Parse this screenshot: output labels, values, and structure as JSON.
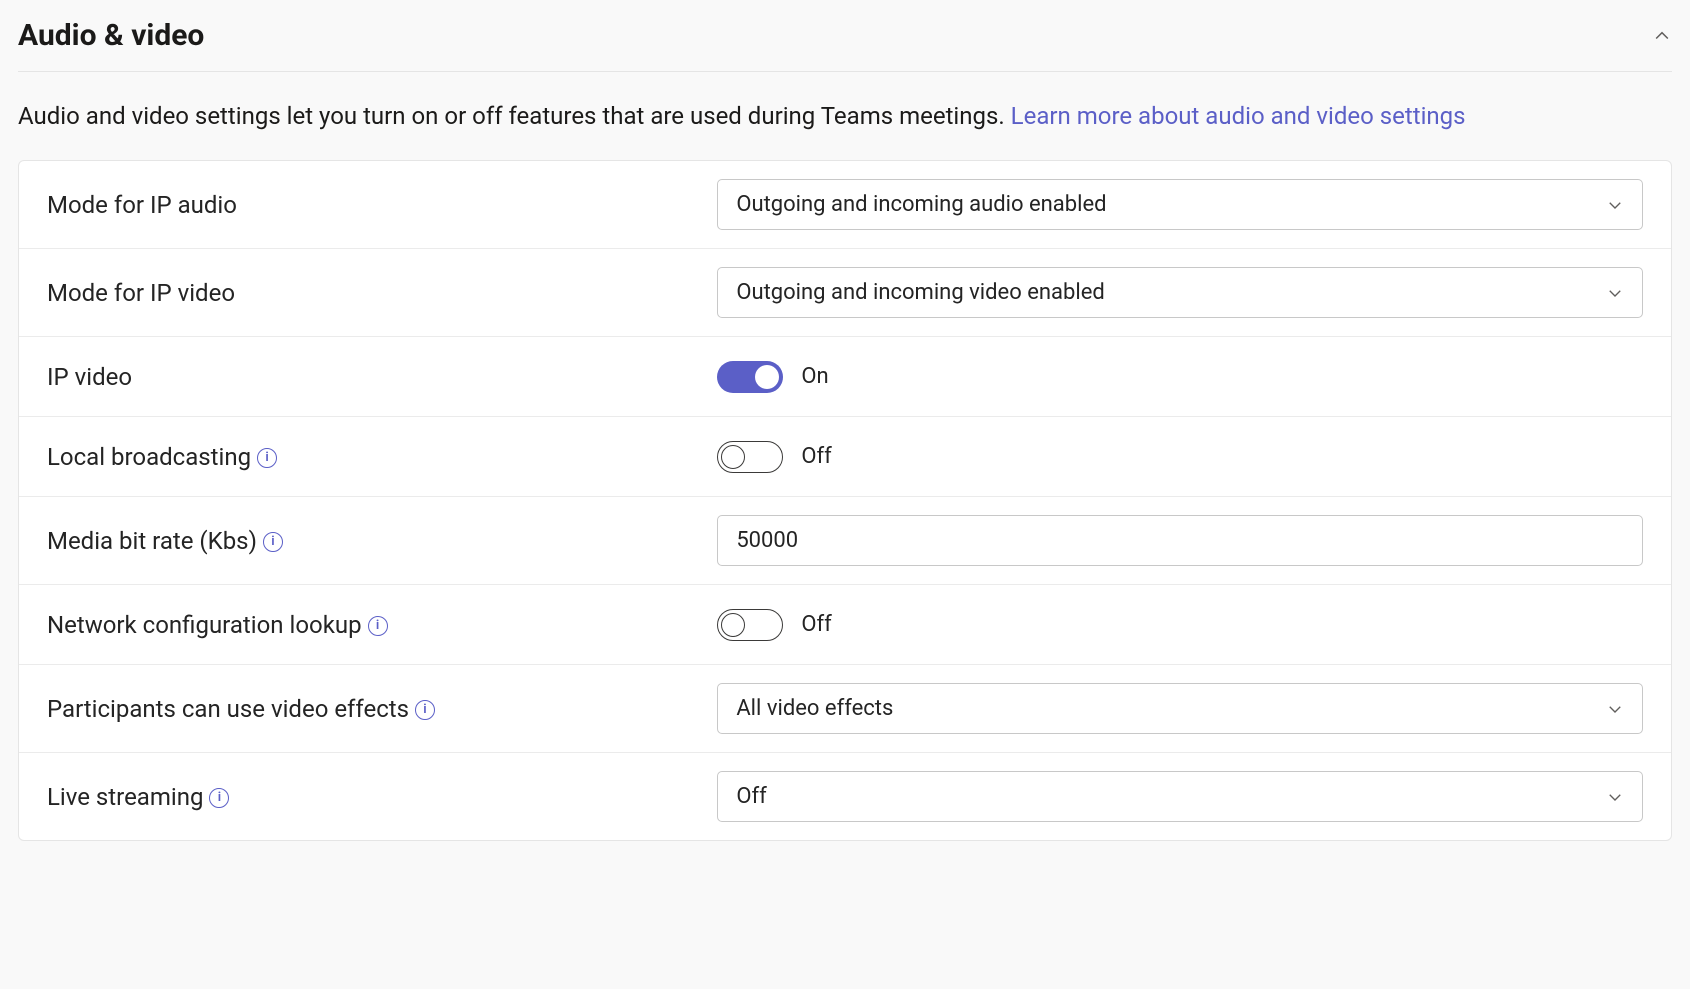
{
  "section": {
    "title": "Audio & video",
    "description_pre": "Audio and video settings let you turn on or off features that are used during Teams meetings. ",
    "learn_more": "Learn more about audio and video settings"
  },
  "toggle_states": {
    "on": "On",
    "off": "Off"
  },
  "rows": {
    "ip_audio_mode": {
      "label": "Mode for IP audio",
      "value": "Outgoing and incoming audio enabled"
    },
    "ip_video_mode": {
      "label": "Mode for IP video",
      "value": "Outgoing and incoming video enabled"
    },
    "ip_video": {
      "label": "IP video",
      "state": "on"
    },
    "local_broadcasting": {
      "label": "Local broadcasting",
      "state": "off"
    },
    "media_bitrate": {
      "label": "Media bit rate (Kbs)",
      "value": "50000"
    },
    "network_lookup": {
      "label": "Network configuration lookup",
      "state": "off"
    },
    "video_effects": {
      "label": "Participants can use video effects",
      "value": "All video effects"
    },
    "live_streaming": {
      "label": "Live streaming",
      "value": "Off"
    }
  }
}
